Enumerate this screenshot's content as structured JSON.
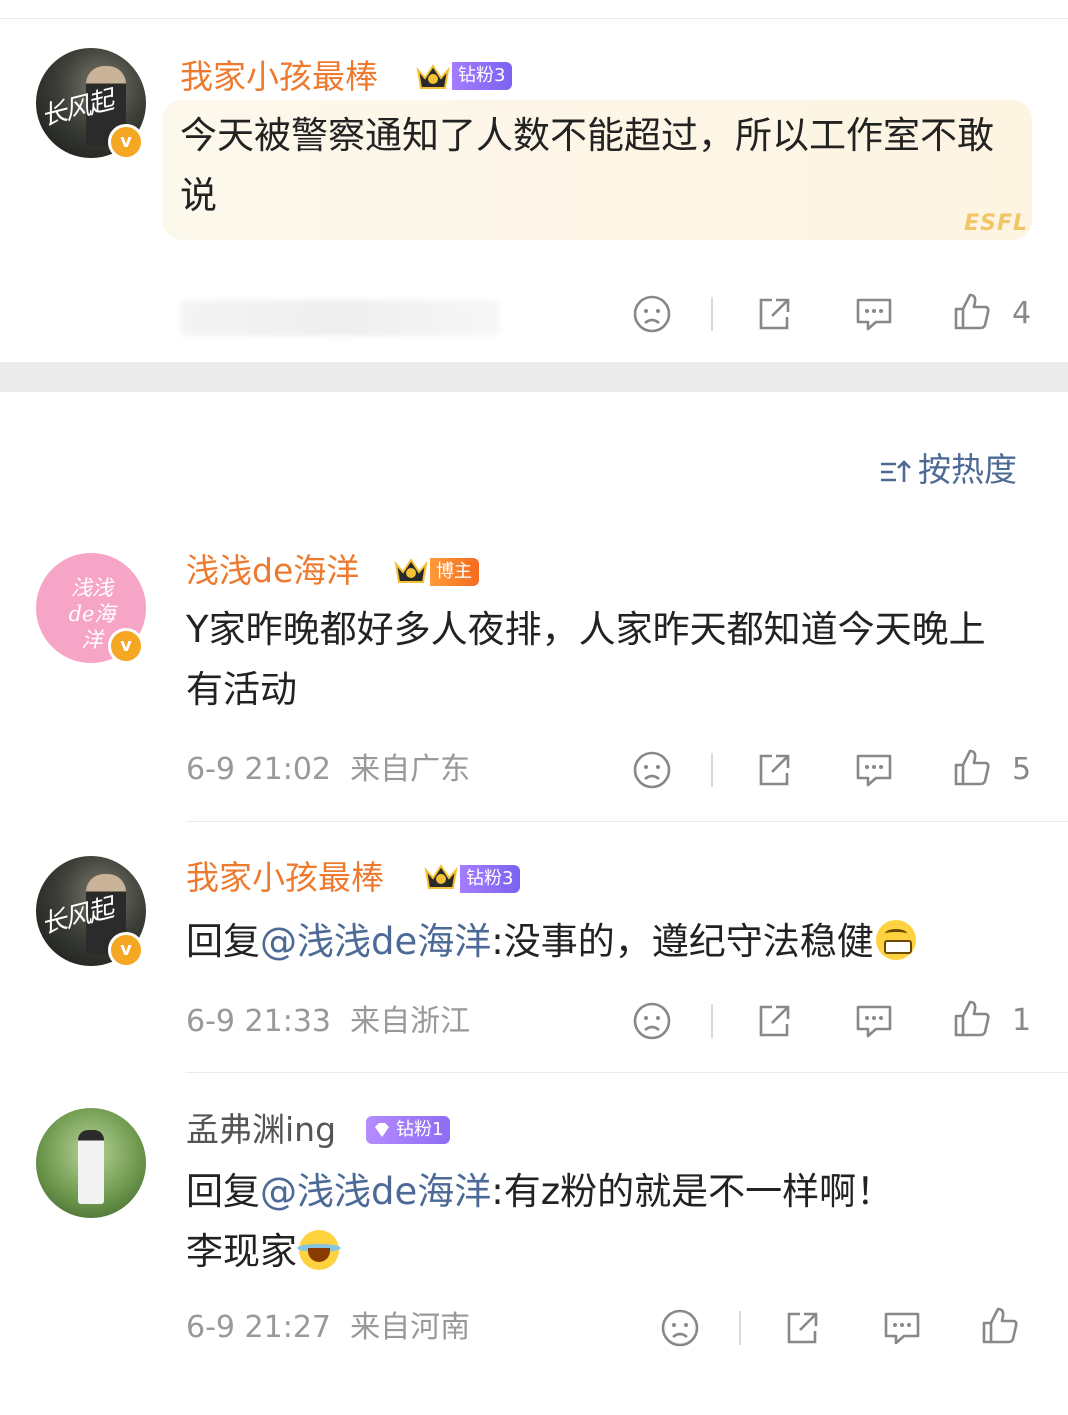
{
  "comments": [
    {
      "username": "我家小孩最棒",
      "tag": "钻粉3",
      "text": "今天被警察通知了人数不能超过，所以工作室不敢说",
      "bubble_deco": "ESFL",
      "likes": "4"
    },
    {
      "username": "浅浅de海洋",
      "tag": "博主",
      "avatar_text": "浅浅de海洋",
      "text": "Y家昨晚都好多人夜排，人家昨天都知道今天晚上有活动",
      "time": "6-9 21:02",
      "location": "来自广东",
      "likes": "5"
    },
    {
      "username": "我家小孩最棒",
      "tag": "钻粉3",
      "reply_prefix": "回复",
      "mention": "@浅浅de海洋",
      "text": ":没事的，遵纪守法稳健",
      "emoji": "grin-emoji",
      "time": "6-9 21:33",
      "location": "来自浙江",
      "likes": "1"
    },
    {
      "username": "孟弗渊ing",
      "tag": "钻粉1",
      "reply_prefix": "回复",
      "mention": "@浅浅de海洋",
      "text": ":有z粉的就是不一样啊！",
      "text2": "李现家",
      "emoji": "laugh-cry-emoji",
      "time": "6-9 21:27",
      "location": "来自河南",
      "likes": ""
    }
  ],
  "sort_label": "按热度",
  "colors": {
    "username": "#ee7a2f",
    "mention": "#4c6a95",
    "meta": "#999999",
    "verified": "#f5a623"
  }
}
